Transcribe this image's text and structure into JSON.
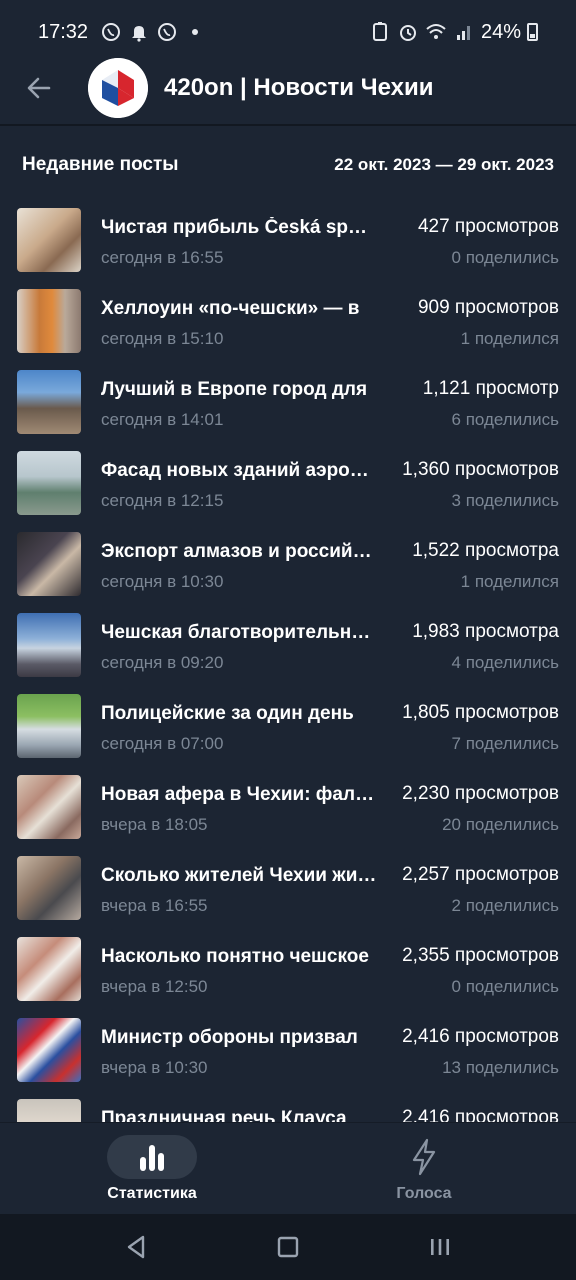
{
  "status_bar": {
    "time": "17:32",
    "battery": "24%"
  },
  "header": {
    "channel_title": "420on | Новости Чехии"
  },
  "section": {
    "title": "Недавние посты",
    "date_range": "22 окт. 2023 — 29 окт. 2023"
  },
  "posts": [
    {
      "title": "Чистая прибыль Česká spořitelna",
      "time": "сегодня в 16:55",
      "views": "427 просмотров",
      "shares": "0 поделились"
    },
    {
      "title": "Хеллоуин «по-чешски» — в",
      "time": "сегодня в 15:10",
      "views": "909 просмотров",
      "shares": "1 поделился"
    },
    {
      "title": "Лучший в Европе город для",
      "time": "сегодня в 14:01",
      "views": "1,121 просмотр",
      "shares": "6 поделились"
    },
    {
      "title": "Фасад новых зданий аэропорта",
      "time": "сегодня в 12:15",
      "views": "1,360 просмотров",
      "shares": "3 поделились"
    },
    {
      "title": "Экспорт алмазов и российских",
      "time": "сегодня в 10:30",
      "views": "1,522 просмотра",
      "shares": "1 поделился"
    },
    {
      "title": "Чешская благотворительность",
      "time": "сегодня в 09:20",
      "views": "1,983 просмотра",
      "shares": "4 поделились"
    },
    {
      "title": "Полицейские за один день",
      "time": "сегодня в 07:00",
      "views": "1,805 просмотров",
      "shares": "7 поделились"
    },
    {
      "title": "Новая афера в Чехии: фальшивые",
      "time": "вчера в 18:05",
      "views": "2,230 просмотров",
      "shares": "20 поделились"
    },
    {
      "title": "Сколько жителей Чехии живут",
      "time": "вчера в 16:55",
      "views": "2,257 просмотров",
      "shares": "2 поделились"
    },
    {
      "title": "Насколько понятно чешское",
      "time": "вчера в 12:50",
      "views": "2,355 просмотров",
      "shares": "0 поделились"
    },
    {
      "title": "Министр обороны призвал",
      "time": "вчера в 10:30",
      "views": "2,416 просмотров",
      "shares": "13 поделились"
    },
    {
      "title": "Праздничная речь Клауса",
      "time": "",
      "views": "2,416 просмотров",
      "shares": ""
    }
  ],
  "bottom_nav": {
    "tabs": [
      {
        "label": "Статистика",
        "icon": "bar-chart-icon",
        "active": true
      },
      {
        "label": "Голоса",
        "icon": "lightning-icon",
        "active": false
      }
    ]
  },
  "colors": {
    "background": "#1c2533",
    "secondary_text": "#7c8795",
    "active_pill": "#313b49",
    "system_nav": "#121821"
  }
}
